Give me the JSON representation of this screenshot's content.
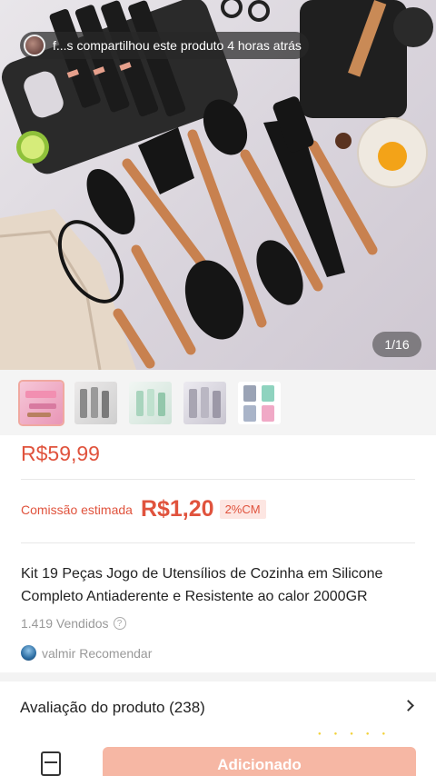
{
  "share": {
    "text": "f...s compartilhou este produto 4 horas atrás"
  },
  "gallery": {
    "counter": "1/16",
    "selected_index": 0,
    "thumb_count": 5
  },
  "product": {
    "price": "R$59,99",
    "commission_label": "Comissão estimada",
    "commission_value": "R$1,20",
    "commission_badge": "2%CM",
    "title": "Kit 19 Peças  Jogo de Utensílios de Cozinha em Silicone Completo Antiaderente e Resistente ao calor 2000GR",
    "sold": "1.419 Vendidos",
    "recommender": "valmir Recomendar"
  },
  "reviews": {
    "title": "Avaliação do produto (238)"
  },
  "bottom": {
    "added_label": "Adicionado"
  },
  "colors": {
    "accent": "#e0533d",
    "badge_bg": "#fde6e2",
    "button_bg": "#f6b7a4"
  },
  "icons": {
    "help": "help-circle-icon",
    "chevron": "chevron-right-icon",
    "cart": "cart-icon"
  }
}
